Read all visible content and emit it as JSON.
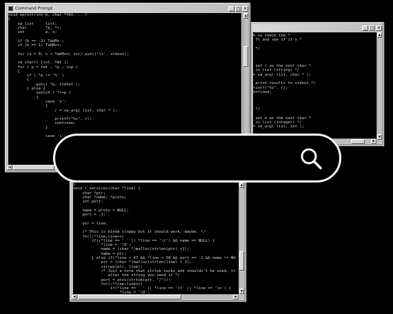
{
  "windows": {
    "back_left": {
      "title": "Command Prompt",
      "code": "void eprint(int b, char *fmt, ...)\n{\n    va_list     list;\n    char        *p, *r;\n    int         e, x;\n\n    if (b == -1) TabM+-;\n    if (b == 1) TabM++;\n\n    for (x = 0; x < TabM+n; x++) putc('\\t', stdout);\n\n    va_start( list, fmt );\n    for ( p = fmt ; *p ; ++p )\n    {\n        if ( *p != '%' )\n        {\n            putc( *p, stdout );\n        } else {\n            switch ( *++p )\n            {\n                case 's':\n                {\n                    r = va_arg( list, char * );\n\n                    printf(\"%s\", r);\n                    continue;\n                }\n\n                case 'i':"
    },
    "back_right": {
      "code": "% so check the *\n ft and see if it's *\n\n */\n\n\n\n set r as the next char *\n in list (string) */\n= va_arg( list, char * );\n\n print results to stdout */\nrintf(\"%s\", r);\nontinue;\n\n\n\n */\n\n set e as the next char *\n in list (integer) */\n= va_arg( list, int );"
    },
    "front_bottom": {
      "code": "}\nvoid r_services(char *line) {\n    char *ptr;\n    char *name, *proto;\n    int port;\n\n    name = proto = NULL;\n    port = -1;\n\n    ptr = line;\n\n    /* This is kinda sloppy but it should work, maybe. */\n    for(;*line;line++)\n        if((*line == ' ' || *line == '\\t') && name == NULL) {\n            *line = '\\0';\n            name = (char *)malloc(strlen(ptr) +1);\n            name = ptr;\n        } else if(*line > 47 && *line < 58 && port == -1 && name != NU\n            ptr = (char *)malloc(strlen(line) + 1);\n            strcpy(ptr, line);\n            /* Just a note that strtok sucks and shouldn't be used, it\n               alter the string you send it */\n            port = atoi(strtok(ptr, \"/\"));\n            for(;*line;line++)\n                if(*line == ' ' || *line == '\\t' || *line == '\\n') {\n                    *line = '\\0';"
    }
  },
  "search": {
    "value": "",
    "placeholder": "",
    "icon": "magnifier-icon"
  },
  "colors": {
    "background": "#000000",
    "console_text": "#d6d6d6",
    "chrome": "#c3c3c3",
    "search_border": "#ffffff"
  }
}
